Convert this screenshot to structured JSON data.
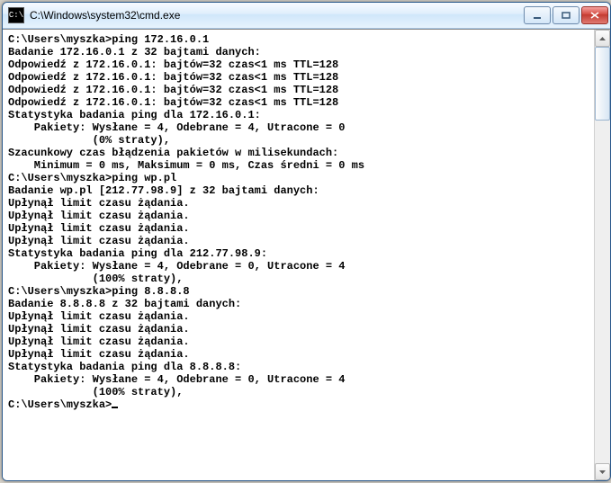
{
  "window": {
    "title": "C:\\Windows\\system32\\cmd.exe",
    "icon_label": "C:\\"
  },
  "lines": [
    "",
    "C:\\Users\\myszka>ping 172.16.0.1",
    "",
    "Badanie 172.16.0.1 z 32 bajtami danych:",
    "Odpowiedź z 172.16.0.1: bajtów=32 czas<1 ms TTL=128",
    "Odpowiedź z 172.16.0.1: bajtów=32 czas<1 ms TTL=128",
    "Odpowiedź z 172.16.0.1: bajtów=32 czas<1 ms TTL=128",
    "Odpowiedź z 172.16.0.1: bajtów=32 czas<1 ms TTL=128",
    "",
    "Statystyka badania ping dla 172.16.0.1:",
    "    Pakiety: Wysłane = 4, Odebrane = 4, Utracone = 0",
    "             (0% straty),",
    "Szacunkowy czas błądzenia pakietów w milisekundach:",
    "    Minimum = 0 ms, Maksimum = 0 ms, Czas średni = 0 ms",
    "",
    "C:\\Users\\myszka>ping wp.pl",
    "",
    "Badanie wp.pl [212.77.98.9] z 32 bajtami danych:",
    "Upłynął limit czasu żądania.",
    "Upłynął limit czasu żądania.",
    "Upłynął limit czasu żądania.",
    "Upłynął limit czasu żądania.",
    "",
    "Statystyka badania ping dla 212.77.98.9:",
    "    Pakiety: Wysłane = 4, Odebrane = 0, Utracone = 4",
    "             (100% straty),",
    "",
    "C:\\Users\\myszka>ping 8.8.8.8",
    "",
    "Badanie 8.8.8.8 z 32 bajtami danych:",
    "Upłynął limit czasu żądania.",
    "Upłynął limit czasu żądania.",
    "Upłynął limit czasu żądania.",
    "Upłynął limit czasu żądania.",
    "",
    "Statystyka badania ping dla 8.8.8.8:",
    "    Pakiety: Wysłane = 4, Odebrane = 0, Utracone = 4",
    "             (100% straty),",
    "",
    "C:\\Users\\myszka>"
  ],
  "prompt_cursor": "_"
}
